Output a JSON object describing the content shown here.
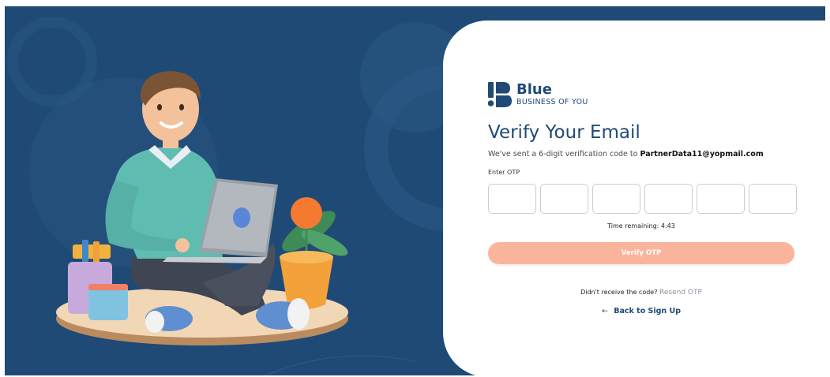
{
  "brand": {
    "name": "Blue",
    "tagline": "BUSINESS OF YOU",
    "logo_icon": "brand-logo-icon"
  },
  "colors": {
    "background": "#1f4a76",
    "primary": "#1f4a76",
    "button": "#fbb49c",
    "resend_link": "#8a94a0"
  },
  "verify": {
    "title": "Verify Your Email",
    "subtitle_prefix": "We've sent a 6-digit verification code to",
    "email": "PartnerData11@yopmail.com",
    "otp_label": "Enter OTP",
    "otp_digits": [
      "",
      "",
      "",
      "",
      "",
      ""
    ],
    "timer_label": "Time remaining:",
    "timer_value": "4:43",
    "button_label": "Verify OTP",
    "resend_prompt": "Didn't receive the code?",
    "resend_label": "Resend OTP",
    "back_icon": "arrow-left-icon",
    "back_label": "Back to Sign Up"
  },
  "illustration": {
    "description_icon": "person-with-laptop-illustration"
  }
}
